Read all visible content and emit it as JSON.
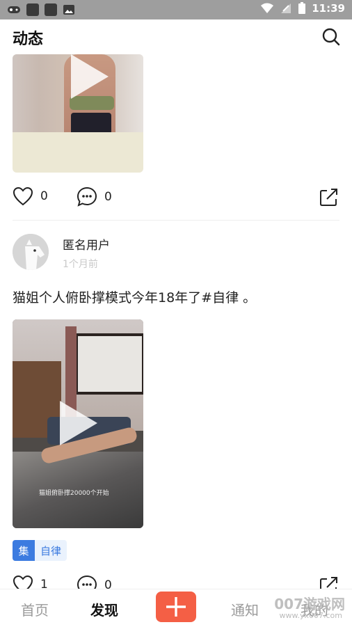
{
  "status_bar": {
    "time": "11:39",
    "icons": [
      "gamepad-icon",
      "square-icon",
      "square-icon",
      "image-icon",
      "wifi-icon",
      "signal-icon",
      "battery-icon"
    ]
  },
  "header": {
    "title": "动态",
    "search_icon": "search-icon"
  },
  "post1": {
    "likes": "0",
    "comments": "0"
  },
  "post2": {
    "username": "匿名用户",
    "time": "1个月前",
    "text": "猫姐个人俯卧撑模式今年18年了#自律 。",
    "video_caption": "猫姐俯卧撑20000个开始",
    "tag_icon": "集",
    "tag_label": "自律",
    "likes": "1",
    "comments": "0"
  },
  "bottom_nav": {
    "items": [
      "首页",
      "发现",
      "通知",
      "我的"
    ],
    "active": "发现",
    "add_icon": "plus-icon"
  },
  "watermark": {
    "main": "007游戏网",
    "sub": "www.yx007.com"
  },
  "colors": {
    "accent": "#f45f45",
    "tag_blue": "#3c7be0",
    "status_bar": "#9e9e9e"
  }
}
